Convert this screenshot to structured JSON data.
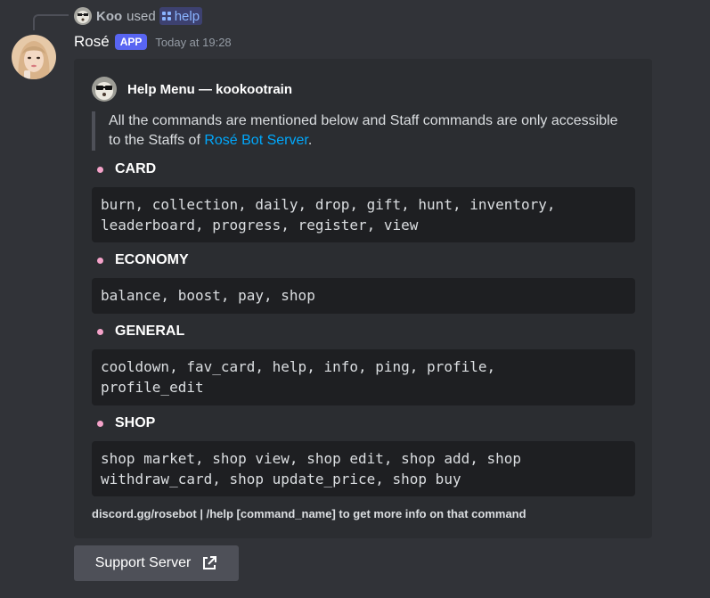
{
  "reply": {
    "user_name": "Koo",
    "used_text": "used",
    "command": "help"
  },
  "message": {
    "author": "Rosé",
    "badge": "APP",
    "timestamp": "Today at 19:28"
  },
  "embed": {
    "author": "Help Menu — kookootrain",
    "description_prefix": "All the commands are mentioned below and Staff commands are only accessible to the Staffs of ",
    "description_link": "Rosé Bot Server",
    "description_suffix": ".",
    "sections": [
      {
        "title": "CARD",
        "commands": "burn, collection, daily, drop, gift, hunt, inventory,\nleaderboard, progress, register, view"
      },
      {
        "title": "ECONOMY",
        "commands": "balance, boost, pay, shop"
      },
      {
        "title": "GENERAL",
        "commands": "cooldown, fav_card, help, info, ping, profile,\nprofile_edit"
      },
      {
        "title": "SHOP",
        "commands": "shop market, shop view, shop edit, shop add, shop\nwithdraw_card, shop update_price, shop buy"
      }
    ],
    "footer": "discord.gg/rosebot | /help [command_name] to get more info on that command"
  },
  "button": {
    "label": "Support Server",
    "icon": "external-link-icon"
  },
  "colors": {
    "background": "#313338",
    "embed_background": "#2b2d31",
    "codeblock_background": "#1e1f22",
    "link": "#00a8fc",
    "badge": "#5865f2",
    "bullet": "#f4a2c9"
  }
}
